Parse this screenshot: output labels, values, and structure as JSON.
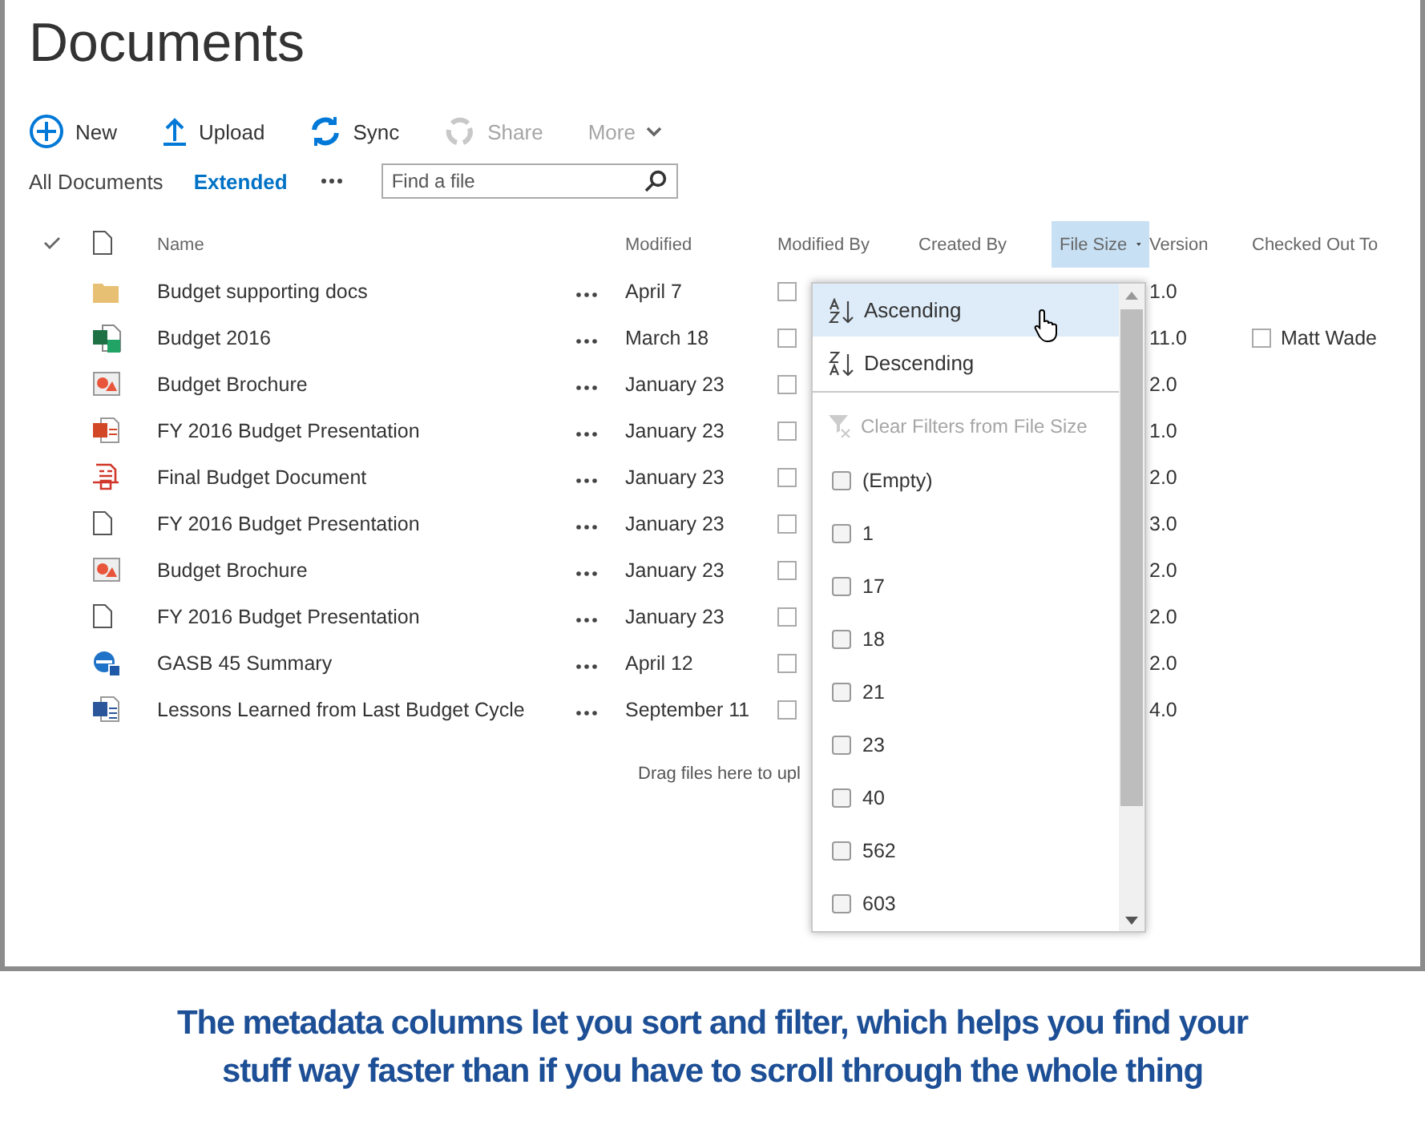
{
  "page_title": "Documents",
  "toolbar": [
    {
      "kind": "new",
      "label": "New",
      "disabled": false
    },
    {
      "kind": "upload",
      "label": "Upload",
      "disabled": false
    },
    {
      "kind": "sync",
      "label": "Sync",
      "disabled": false
    },
    {
      "kind": "share",
      "label": "Share",
      "disabled": true
    },
    {
      "kind": "more",
      "label": "More",
      "disabled": true
    }
  ],
  "views": [
    {
      "label": "All Documents",
      "selected": false
    },
    {
      "label": "Extended",
      "selected": true
    }
  ],
  "search": {
    "placeholder": "Find a file"
  },
  "columns": [
    {
      "label": "Name",
      "menu_open": false
    },
    {
      "label": "Modified",
      "menu_open": false
    },
    {
      "label": "Modified By",
      "menu_open": false
    },
    {
      "label": "Created By",
      "menu_open": false
    },
    {
      "label": "File Size",
      "menu_open": true
    },
    {
      "label": "Version",
      "menu_open": false
    },
    {
      "label": "Checked Out To",
      "menu_open": false
    }
  ],
  "rows": [
    {
      "kind": "folder",
      "name": "Budget supporting docs",
      "modified": "April 7",
      "modified_by_checked": false,
      "version": "1.0"
    },
    {
      "kind": "excel",
      "name": "Budget 2016",
      "modified": "March 18",
      "modified_by_checked": false,
      "version": "11.0",
      "checked_out_to": "Matt Wade",
      "checked_out_checked": false
    },
    {
      "kind": "image",
      "name": "Budget Brochure",
      "modified": "January 23",
      "modified_by_checked": false,
      "version": "2.0"
    },
    {
      "kind": "powerpoint",
      "name": "FY 2016 Budget Presentation",
      "modified": "January 23",
      "modified_by_checked": false,
      "version": "1.0"
    },
    {
      "kind": "pdf",
      "name": "Final Budget Document",
      "modified": "January 23",
      "modified_by_checked": false,
      "version": "2.0"
    },
    {
      "kind": "file",
      "name": "FY 2016 Budget Presentation",
      "modified": "January 23",
      "modified_by_checked": false,
      "version": "3.0"
    },
    {
      "kind": "image",
      "name": "Budget Brochure",
      "modified": "January 23",
      "modified_by_checked": false,
      "version": "2.0"
    },
    {
      "kind": "file",
      "name": "FY 2016 Budget Presentation",
      "modified": "January 23",
      "modified_by_checked": false,
      "version": "2.0"
    },
    {
      "kind": "web",
      "name": "GASB 45 Summary",
      "modified": "April 12",
      "modified_by_checked": false,
      "version": "2.0"
    },
    {
      "kind": "word",
      "name": "Lessons Learned from Last Budget Cycle",
      "modified": "September 11",
      "modified_by_checked": false,
      "version": "4.0"
    }
  ],
  "drop_hint": "Drag files here to upl",
  "column_menu": {
    "sort_options": [
      {
        "kind": "ascending",
        "label": "Ascending",
        "hovered": true
      },
      {
        "kind": "descending",
        "label": "Descending",
        "hovered": false
      }
    ],
    "clear_filter": {
      "label": "Clear Filters from File Size",
      "disabled": true
    },
    "filter_values": [
      {
        "label": "(Empty)",
        "checked": false
      },
      {
        "label": "1",
        "checked": false
      },
      {
        "label": "17",
        "checked": false
      },
      {
        "label": "18",
        "checked": false
      },
      {
        "label": "21",
        "checked": false
      },
      {
        "label": "23",
        "checked": false
      },
      {
        "label": "40",
        "checked": false
      },
      {
        "label": "562",
        "checked": false
      },
      {
        "label": "603",
        "checked": false
      }
    ]
  },
  "caption": [
    "The metadata columns let you sort and filter, which helps you find your",
    "stuff way faster than if you have to scroll through the whole thing"
  ]
}
